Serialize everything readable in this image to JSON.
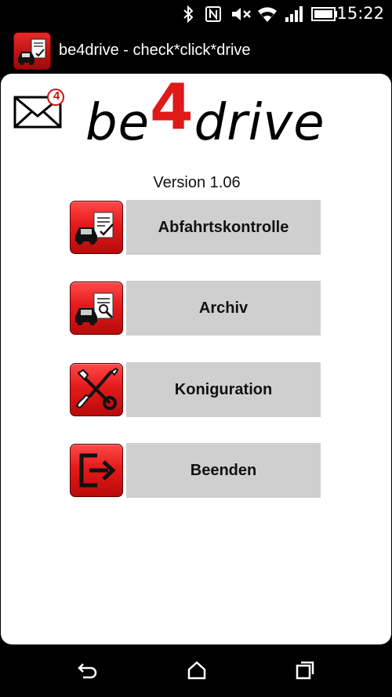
{
  "status_bar": {
    "time": "15:22",
    "icons": [
      "bluetooth-icon",
      "nfc-icon",
      "mute-icon",
      "wifi-icon",
      "signal-icon",
      "battery-icon"
    ]
  },
  "app_bar": {
    "title": "be4drive - check*click*drive",
    "icon": "car-checklist-icon"
  },
  "header": {
    "logo_prefix": "be",
    "logo_number": "4",
    "logo_suffix": "drive",
    "mail_badge": "4",
    "version": "Version 1.06"
  },
  "menu": [
    {
      "label": "Abfahrtskontrolle",
      "icon": "car-checklist-icon"
    },
    {
      "label": "Archiv",
      "icon": "car-search-icon"
    },
    {
      "label": "Koniguration",
      "icon": "tools-icon"
    },
    {
      "label": "Beenden",
      "icon": "exit-icon"
    }
  ],
  "colors": {
    "accent_red": "#e01919",
    "button_gray": "#cfcfcf",
    "background": "#ffffff"
  },
  "nav_bar": {
    "icons": [
      "back-icon",
      "home-icon",
      "recents-icon"
    ]
  }
}
